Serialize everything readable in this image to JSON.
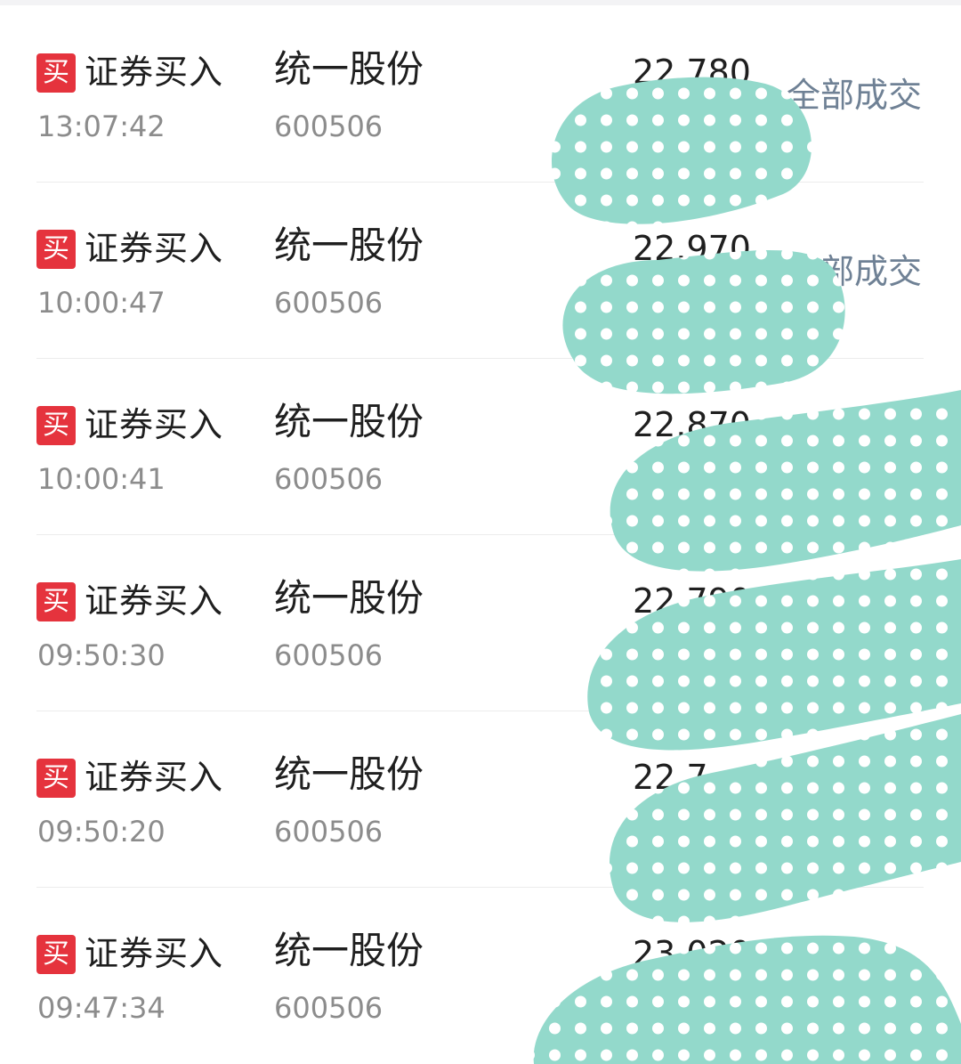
{
  "colors": {
    "buy_badge": "#e5333d",
    "status_text": "#6f8195",
    "redaction_fill": "#93d9cb",
    "redaction_dots": "#ffffff"
  },
  "orders": [
    {
      "badge": "买",
      "type": "证券买入",
      "time": "13:07:42",
      "name": "统一股份",
      "code": "600506",
      "price": "22.780",
      "status": "全部成交"
    },
    {
      "badge": "买",
      "type": "证券买入",
      "time": "10:00:47",
      "name": "统一股份",
      "code": "600506",
      "price": "22.970",
      "status": "部成交"
    },
    {
      "badge": "买",
      "type": "证券买入",
      "time": "10:00:41",
      "name": "统一股份",
      "code": "600506",
      "price": "22.870",
      "status": ""
    },
    {
      "badge": "买",
      "type": "证券买入",
      "time": "09:50:30",
      "name": "统一股份",
      "code": "600506",
      "price": "22.790",
      "status": ""
    },
    {
      "badge": "买",
      "type": "证券买入",
      "time": "09:50:20",
      "name": "统一股份",
      "code": "600506",
      "price": "22.7",
      "status": ""
    },
    {
      "badge": "买",
      "type": "证券买入",
      "time": "09:47:34",
      "name": "统一股份",
      "code": "600506",
      "price": "23.020",
      "status": ""
    }
  ],
  "redaction": {
    "icon": "polka-dot-scribble"
  }
}
